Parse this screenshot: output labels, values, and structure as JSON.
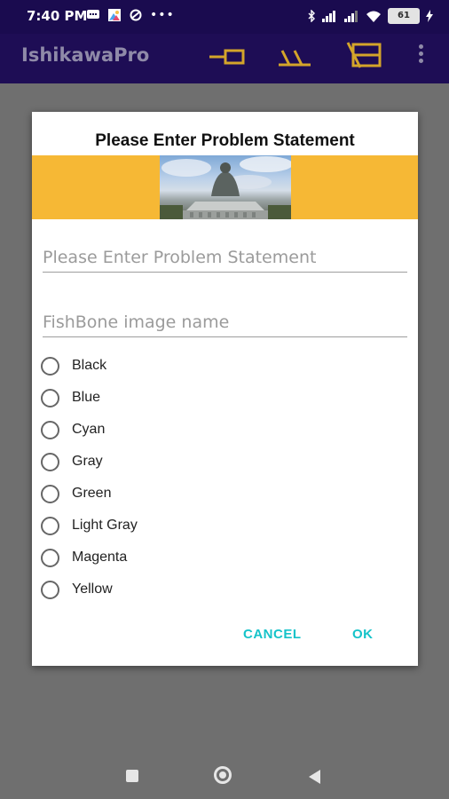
{
  "status_bar": {
    "time": "7:40 PM",
    "battery_level": "61",
    "icons": [
      "message-icon",
      "photos-icon",
      "sync-icon",
      "more-dots-icon",
      "bluetooth-icon",
      "signal-icon",
      "signal-icon",
      "wifi-icon",
      "battery-icon",
      "charging-icon"
    ]
  },
  "app_bar": {
    "title": "IshikawaPro",
    "actions": [
      "fishbone-head-icon",
      "fishbone-bones-icon",
      "fishbone-full-icon",
      "overflow-menu-icon"
    ]
  },
  "dialog": {
    "title": "Please Enter Problem Statement",
    "problem_input": {
      "value": "",
      "placeholder": "Please Enter Problem Statement"
    },
    "image_name_input": {
      "value": "",
      "placeholder": "FishBone image name"
    },
    "color_options": [
      "Black",
      "Blue",
      "Cyan",
      "Gray",
      "Green",
      "Light Gray",
      "Magenta",
      "Yellow"
    ],
    "cancel_label": "CANCEL",
    "ok_label": "OK"
  },
  "colors": {
    "app_bar": "#1e0d55",
    "banner": "#f6b835",
    "accent": "#15c3c9",
    "scrim": "#6f6f6f"
  }
}
